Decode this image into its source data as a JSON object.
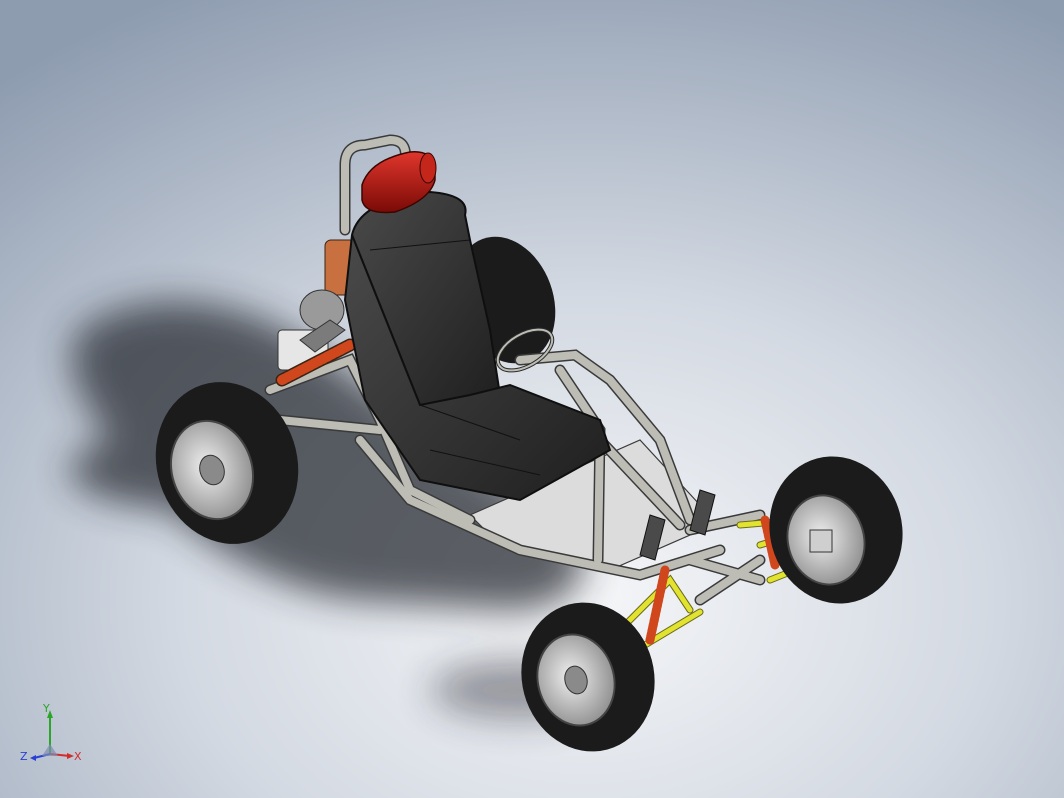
{
  "colors": {
    "background_top": "#8c9bb0",
    "background_bottom": "#f2f4f7",
    "tube": "#b9b9b4",
    "tube_edge": "#3a3a3a",
    "tire": "#1b1b1b",
    "rim": "#c8c8c8",
    "seat": "#2e2e2e",
    "headrest": "#b0120e",
    "spring": "#d0471e",
    "a_arm": "#e2e230",
    "floor": "#d9d9d9",
    "axis_x": "#d42b2b",
    "axis_y": "#2aa52a",
    "axis_z": "#2b3fd4"
  },
  "model": {
    "description_icon": "go-kart-assembly-icon"
  },
  "triad": {
    "x_label": "X",
    "y_label": "Y",
    "z_label": "Z"
  }
}
